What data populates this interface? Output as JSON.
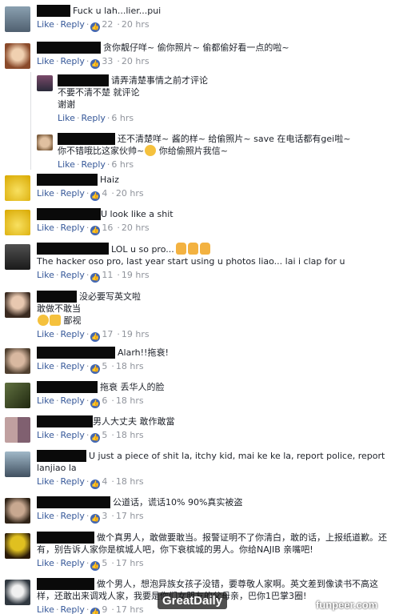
{
  "comments": [
    {
      "id": "c1",
      "text": "Fuck u lah...lier...pui",
      "likes": "22",
      "time": "20 hrs",
      "avatar": "#5a7a8a"
    },
    {
      "id": "c2",
      "text": "贪你靓仔咩~ 偷你照片~ 偷都偷好看一点的啦~",
      "likes": "33",
      "time": "20 hrs",
      "avatar": "#b06a3c"
    },
    {
      "id": "r1",
      "lines": [
        "请弄清楚事情之前才评论",
        "不要不清不楚 就评论",
        "谢谢"
      ],
      "time": "6 hrs",
      "avatar": "#5a3a4a"
    },
    {
      "id": "r2",
      "lines": [
        "还不清楚咩~ 酱的样~ 给偷照片~ save 在电话都有gei啦~",
        "你不错哦比这家伙帅~",
        "你给偷照片我信~"
      ],
      "time": "6 hrs",
      "avatar": "#b89070"
    },
    {
      "id": "c3",
      "text": "Haiz",
      "likes": "4",
      "time": "20 hrs",
      "avatar": "#e8c020"
    },
    {
      "id": "c4",
      "text": "U look like a shit",
      "likes": "16",
      "time": "20 hrs",
      "avatar": "#e8c020"
    },
    {
      "id": "c5",
      "text": "LOL u so pro...",
      "text2": "The hacker oso pro, last year start using u photos liao... lai i clap for u",
      "likes": "11",
      "time": "19 hrs",
      "avatar": "#3a3a3a"
    },
    {
      "id": "c6",
      "text": "没必要写英文啦",
      "text2": "敢做不敢当",
      "text3": "鄙视",
      "likes": "17",
      "time": "19 hrs",
      "avatar": "#7a5a50"
    },
    {
      "id": "c7",
      "text": "Alarh!!拖衰!",
      "likes": "5",
      "time": "18 hrs",
      "avatar": "#6a5040"
    },
    {
      "id": "c8",
      "text": "拖衰 丢华人的脸",
      "likes": "6",
      "time": "18 hrs",
      "avatar": "#3a4020"
    },
    {
      "id": "c9",
      "text": "男人大丈夫 敢作敢當",
      "likes": "5",
      "time": "18 hrs",
      "avatar": "#a08080"
    },
    {
      "id": "c10",
      "text": "U just a piece of shit la, itchy kid, mai ke ke la, report police, report lanjiao la",
      "likes": "4",
      "time": "18 hrs",
      "avatar": "#607080"
    },
    {
      "id": "c11",
      "text": "公道话，谎话10% 90%真实被盗",
      "likes": "3",
      "time": "17 hrs",
      "avatar": "#504030"
    },
    {
      "id": "c12",
      "text": "做个真男人，敢做要敢当。报警证明不了你清白，敢的话，上报纸道歉。还有，别告诉人家你是槟城人吧，你下衰槟城的男人。你给NAJIB 亲嘴吧!",
      "likes": "5",
      "time": "17 hrs",
      "avatar": "#302010"
    },
    {
      "id": "c13",
      "text": "做个男人，想泡异族女孩子没错，要尊敬人家啊。英文差到像读书不高这样，还敢出来调戏人家，我要是你们女朋友的父母亲，巴你1巴掌3圈!",
      "likes": "9",
      "time": "17 hrs",
      "avatar": "#404850"
    }
  ],
  "labels": {
    "like": "Like",
    "reply": "Reply",
    "sep": "·"
  },
  "watermarks": {
    "left": "GreatDaily",
    "right": "funpeer.com"
  }
}
